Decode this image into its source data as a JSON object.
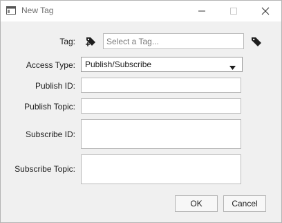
{
  "window": {
    "title": "New Tag"
  },
  "icons": {
    "app": "window-app-icon",
    "minimize": "minimize-icon",
    "maximize": "maximize-icon",
    "close": "close-icon",
    "add_tag": "add-tag-icon",
    "tag": "tag-icon",
    "dropdown": "chevron-down-icon"
  },
  "form": {
    "tag_label": "Tag:",
    "tag_placeholder": "Select a Tag...",
    "access_type_label": "Access Type:",
    "access_type_value": "Publish/Subscribe",
    "publish_id_label": "Publish ID:",
    "publish_id_value": "",
    "publish_topic_label": "Publish Topic:",
    "publish_topic_value": "",
    "subscribe_id_label": "Subscribe ID:",
    "subscribe_id_value": "",
    "subscribe_topic_label": "Subscribe Topic:",
    "subscribe_topic_value": ""
  },
  "buttons": {
    "ok": "OK",
    "cancel": "Cancel"
  }
}
